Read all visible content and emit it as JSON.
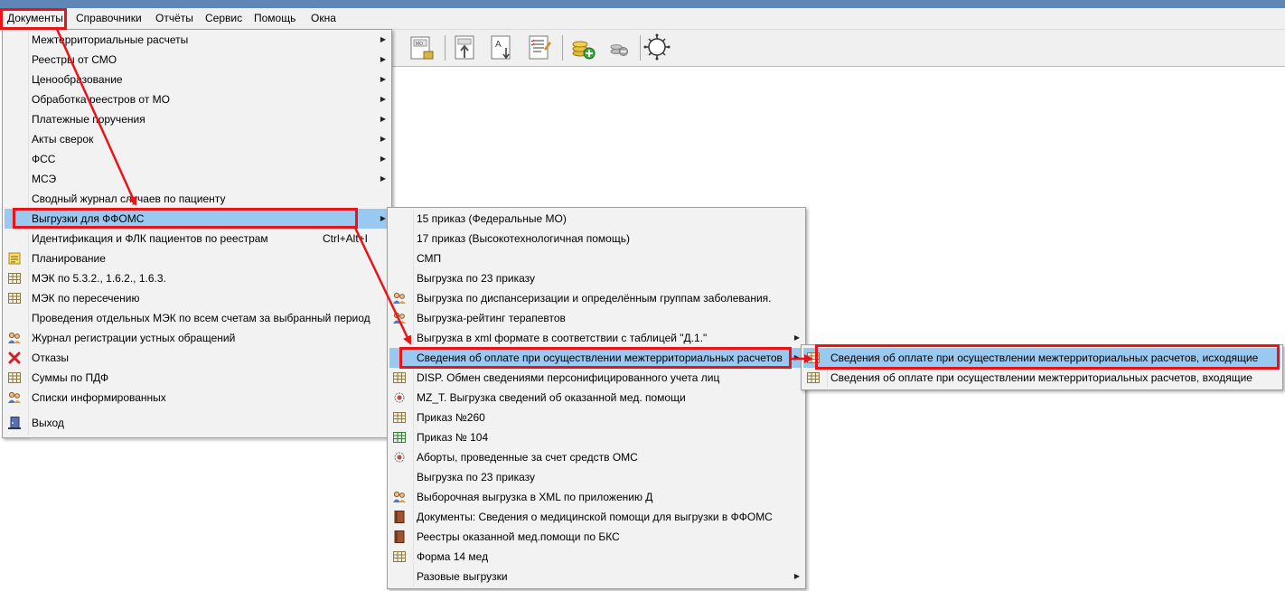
{
  "menubar": {
    "items": [
      "Документы",
      "Справочники",
      "Отчёты",
      "Сервис",
      "Помощь",
      "Окна"
    ]
  },
  "toolbar": {
    "icons": [
      "mo-form-icon",
      "upload-icon",
      "font-download-icon",
      "checklist-icon",
      "add-coins-icon",
      "remove-coins-icon",
      "covid-icon"
    ],
    "covid_label": "COVID-19"
  },
  "documents_menu": {
    "items": [
      {
        "label": "Межтерриториальные расчеты",
        "arrow": true,
        "icon": ""
      },
      {
        "label": "Реестры от СМО",
        "arrow": true,
        "icon": ""
      },
      {
        "label": "Ценообразование",
        "arrow": true,
        "icon": ""
      },
      {
        "label": "Обработка реестров от МО",
        "arrow": true,
        "icon": ""
      },
      {
        "label": "Платежные поручения",
        "arrow": true,
        "icon": ""
      },
      {
        "label": "Акты сверок",
        "arrow": true,
        "icon": ""
      },
      {
        "label": "ФСС",
        "arrow": true,
        "icon": ""
      },
      {
        "label": "МСЭ",
        "arrow": true,
        "icon": ""
      },
      {
        "label": "Сводный журнал случаев по пациенту",
        "arrow": false,
        "icon": ""
      },
      {
        "label": "Выгрузки для ФФОМС",
        "arrow": true,
        "icon": "",
        "highlight": true
      },
      {
        "label": "Идентификация и ФЛК пациентов по реестрам",
        "shortcut": "Ctrl+Alt+I",
        "arrow": false,
        "icon": ""
      },
      {
        "label": "Планирование",
        "arrow": false,
        "icon": "note-icon"
      },
      {
        "label": "МЭК по 5.3.2., 1.6.2., 1.6.3.",
        "arrow": false,
        "icon": "grid-icon"
      },
      {
        "label": "МЭК по пересечению",
        "arrow": false,
        "icon": "grid-icon"
      },
      {
        "label": "Проведения отдельных МЭК по всем счетам за выбранный период",
        "arrow": false,
        "icon": ""
      },
      {
        "label": "Журнал регистрации устных обращений",
        "arrow": false,
        "icon": "users-icon"
      },
      {
        "label": "Отказы",
        "arrow": false,
        "icon": "red-x-icon"
      },
      {
        "label": "Суммы по ПДФ",
        "arrow": false,
        "icon": "grid-icon"
      },
      {
        "label": "Списки информированных",
        "arrow": false,
        "icon": "users-icon"
      },
      {
        "label": "Выход",
        "arrow": false,
        "icon": "exit-door-icon"
      }
    ]
  },
  "ffoms_menu": {
    "items": [
      {
        "label": "15 приказ (Федеральные МО)",
        "arrow": false,
        "icon": ""
      },
      {
        "label": "17 приказ (Высокотехнологичная помощь)",
        "arrow": false,
        "icon": ""
      },
      {
        "label": "СМП",
        "arrow": false,
        "icon": ""
      },
      {
        "label": "Выгрузка по 23 приказу",
        "arrow": false,
        "icon": ""
      },
      {
        "label": "Выгрузка по диспансеризации и определённым группам заболевания.",
        "arrow": false,
        "icon": "users-icon"
      },
      {
        "label": "Выгрузка-рейтинг терапевтов",
        "arrow": false,
        "icon": "users-icon"
      },
      {
        "label": "Выгрузка в xml формате в соответствии с таблицей \"Д.1.\"",
        "arrow": true,
        "icon": ""
      },
      {
        "label": "Сведения об оплате при осуществлении межтерриториальных расчетов",
        "arrow": true,
        "icon": "",
        "highlight": true
      },
      {
        "label": "DISP. Обмен сведениями персонифицированного учета лиц",
        "arrow": false,
        "icon": "grid-icon"
      },
      {
        "label": "MZ_T. Выгрузка сведений об оказанной мед. помощи",
        "arrow": false,
        "icon": "gear-icon"
      },
      {
        "label": "Приказ №260",
        "arrow": false,
        "icon": "grid-icon"
      },
      {
        "label": "Приказ № 104",
        "arrow": false,
        "icon": "green-grid-icon"
      },
      {
        "label": "Аборты, проведенные за счет средств ОМС",
        "arrow": false,
        "icon": "gear-icon"
      },
      {
        "label": "Выгрузка по 23 приказу",
        "arrow": false,
        "icon": ""
      },
      {
        "label": "Выборочная выгрузка в XML по приложению Д",
        "arrow": false,
        "icon": "users-icon"
      },
      {
        "label": "Документы: Сведения о медицинской помощи для выгрузки в ФФОМС",
        "arrow": false,
        "icon": "book-icon"
      },
      {
        "label": "Реестры оказанной мед.помощи по БКС",
        "arrow": false,
        "icon": "book-icon"
      },
      {
        "label": "Форма 14 мед",
        "arrow": false,
        "icon": "grid-icon"
      },
      {
        "label": "Разовые выгрузки",
        "arrow": true,
        "icon": ""
      }
    ]
  },
  "payment_menu": {
    "items": [
      {
        "label": "Сведения об оплате при осуществлении межтерриториальных расчетов, исходящие",
        "icon": "grid-icon",
        "highlight": true
      },
      {
        "label": "Сведения об оплате при осуществлении межтерриториальных расчетов, входящие",
        "icon": "grid-icon"
      }
    ]
  },
  "colors": {
    "highlight": "#99c8f0",
    "annotation": "#e8141a",
    "menu_bg": "#f2f2f2",
    "titlebar": "#5f87b5"
  }
}
